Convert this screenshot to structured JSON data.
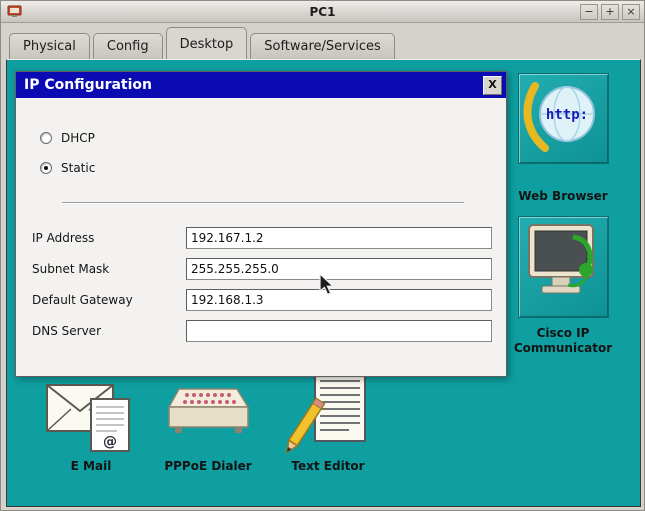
{
  "window": {
    "title": "PC1",
    "controls": [
      {
        "name": "minimize",
        "glyph": "−"
      },
      {
        "name": "maximize",
        "glyph": "+"
      },
      {
        "name": "close",
        "glyph": "×"
      }
    ]
  },
  "tabs": [
    {
      "label": "Physical",
      "active": false
    },
    {
      "label": "Config",
      "active": false
    },
    {
      "label": "Desktop",
      "active": true
    },
    {
      "label": "Software/Services",
      "active": false
    }
  ],
  "dialog": {
    "title": "IP Configuration",
    "close_label": "X",
    "radios": [
      {
        "label": "DHCP",
        "selected": false
      },
      {
        "label": "Static",
        "selected": true
      }
    ],
    "fields": [
      {
        "label": "IP Address",
        "value": "192.167.1.2"
      },
      {
        "label": "Subnet Mask",
        "value": "255.255.255.0"
      },
      {
        "label": "Default Gateway",
        "value": "192.168.1.3"
      },
      {
        "label": "DNS Server",
        "value": ""
      }
    ]
  },
  "desktop": {
    "icons": [
      {
        "id": "web-browser",
        "label": "Web Browser",
        "inner_text": "http:"
      },
      {
        "id": "cisco-ip-communicator",
        "label": "Cisco IP Communicator"
      },
      {
        "id": "email",
        "label": "E Mail",
        "inner_text": "@"
      },
      {
        "id": "pppoe-dialer",
        "label": "PPPoE Dialer"
      },
      {
        "id": "text-editor",
        "label": "Text Editor"
      }
    ]
  },
  "colors": {
    "desktop_teal": "#0f9fa1",
    "dialog_title_blue": "#0b0bb4"
  }
}
